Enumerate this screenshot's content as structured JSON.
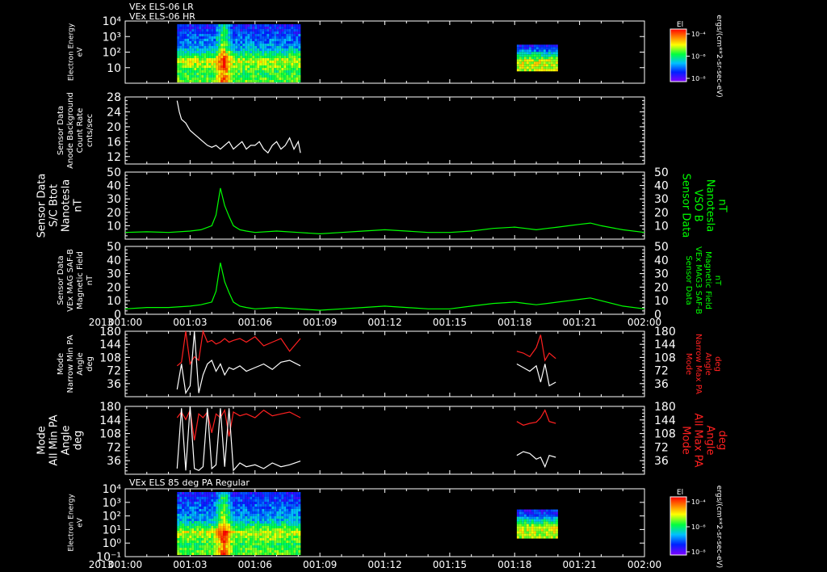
{
  "colors": {
    "white": "#ffffff",
    "green": "#00ff00",
    "red": "#ff2020",
    "background": "#000000"
  },
  "time_axis": {
    "ticks": [
      "001:00",
      "001:03",
      "001:06",
      "001:09",
      "001:12",
      "001:15",
      "001:18",
      "001:21",
      "002:00"
    ],
    "year_label": "2013"
  },
  "chart_data": [
    {
      "id": "panel1",
      "type": "heatmap",
      "titles": [
        "VEx ELS-06 LR",
        "VEx ELS-06 HR"
      ],
      "ylabel": [
        "Electron Energy",
        "eV"
      ],
      "yscale": "log",
      "ylim": [
        1,
        10000
      ],
      "yticks": [
        {
          "v": 10,
          "label": "10"
        },
        {
          "v": 100,
          "label": "10²"
        },
        {
          "v": 1000,
          "label": "10³"
        },
        {
          "v": 10000,
          "label": "10⁴"
        }
      ],
      "colorbar": {
        "title": "El",
        "ticks": [
          "10⁻⁴",
          "10⁻⁶",
          "10⁻⁸"
        ],
        "unit": "ergs/(cm**2-sr-sec-eV)"
      },
      "data_intervals": [
        [
          2.4,
          8.1
        ],
        [
          18.1,
          19.9
        ]
      ]
    },
    {
      "id": "panel2",
      "type": "line",
      "ylabel": [
        "Sensor Data",
        "Anode Background",
        "Count Rate",
        "cnts/sec"
      ],
      "ylim": [
        10,
        28
      ],
      "yticks": [
        12,
        16,
        20,
        24,
        28
      ],
      "series": [
        {
          "color": "white",
          "x": [
            2.4,
            2.5,
            2.6,
            2.8,
            3.0,
            3.2,
            3.4,
            3.6,
            3.8,
            4.0,
            4.2,
            4.4,
            4.6,
            4.8,
            5.0,
            5.2,
            5.4,
            5.6,
            5.8,
            6.0,
            6.2,
            6.4,
            6.6,
            6.8,
            7.0,
            7.2,
            7.4,
            7.6,
            7.8,
            8.0,
            8.1
          ],
          "y": [
            27,
            24,
            22,
            21,
            19,
            18,
            17,
            16,
            15,
            14.5,
            15,
            14,
            15,
            16,
            14,
            15,
            16,
            14,
            15,
            15,
            16,
            14,
            13,
            15,
            16,
            14,
            15,
            17,
            14,
            16,
            13
          ]
        }
      ]
    },
    {
      "id": "panel3",
      "type": "line",
      "ylabel": [
        "Sensor Data",
        "S/C Btot",
        "Nanotesla",
        "nT"
      ],
      "ylabel_right": [
        "Sensor Data",
        "VSO B",
        "Nanotesla",
        "nT"
      ],
      "ylim": [
        0,
        50
      ],
      "yticks": [
        10,
        20,
        30,
        40,
        50
      ],
      "series": [
        {
          "color": "green",
          "x": [
            0,
            1,
            2,
            3,
            3.5,
            4.0,
            4.2,
            4.4,
            4.6,
            4.8,
            5.0,
            5.3,
            5.6,
            6,
            7,
            8,
            9,
            10,
            11,
            12,
            13,
            14,
            15,
            16,
            17,
            18,
            18.5,
            19,
            19.5,
            20,
            20.5,
            21,
            21.5,
            22,
            23,
            24
          ],
          "y": [
            5,
            5.5,
            5,
            6,
            7,
            10,
            18,
            38,
            25,
            17,
            10,
            7,
            6,
            5,
            6,
            5,
            4,
            5,
            6,
            7,
            6,
            5,
            5,
            6,
            8,
            9,
            8,
            7,
            8,
            9,
            10,
            11,
            12,
            10,
            7,
            5
          ]
        }
      ]
    },
    {
      "id": "panel4",
      "type": "line",
      "ylabel": [
        "Sensor Data",
        "VEx MAG SAF-B",
        "Magnetic Field",
        "nT"
      ],
      "ylabel_right": [
        "Sensor Data",
        "VEx MAG3 SAF-B",
        "Magnetic Field",
        "nT"
      ],
      "ylim": [
        0,
        50
      ],
      "yticks": [
        0,
        10,
        20,
        30,
        40,
        50
      ],
      "series": [
        {
          "color": "green",
          "x": [
            0,
            1,
            2,
            3,
            3.5,
            4.0,
            4.2,
            4.4,
            4.6,
            4.8,
            5.0,
            5.3,
            5.6,
            6,
            7,
            8,
            9,
            10,
            11,
            12,
            13,
            14,
            15,
            16,
            17,
            18,
            18.5,
            19,
            19.5,
            20,
            20.5,
            21,
            21.5,
            22,
            23,
            24
          ],
          "y": [
            4,
            5,
            5,
            6,
            7,
            9,
            17,
            38,
            24,
            16,
            9,
            6,
            5,
            4,
            5,
            4,
            3,
            4,
            5,
            6,
            5,
            4,
            4,
            6,
            8,
            9,
            8,
            7,
            8,
            9,
            10,
            11,
            12,
            10,
            6,
            4
          ]
        }
      ]
    },
    {
      "id": "panel5",
      "type": "line",
      "ylabel": [
        "Mode",
        "Narrow Min PA",
        "Angle",
        "deg"
      ],
      "ylabel_right": [
        "Mode",
        "Narrow Max PA",
        "Angle",
        "deg"
      ],
      "ylim": [
        0,
        180
      ],
      "yticks": [
        36,
        72,
        108,
        144,
        180
      ],
      "series": [
        {
          "color": "red",
          "x": [
            2.4,
            2.6,
            2.8,
            3.0,
            3.2,
            3.4,
            3.6,
            3.8,
            4.0,
            4.2,
            4.4,
            4.6,
            4.8,
            5.0,
            5.3,
            5.6,
            6,
            6.4,
            6.8,
            7.2,
            7.6,
            8.1
          ],
          "y": [
            85,
            95,
            180,
            90,
            110,
            100,
            180,
            150,
            155,
            145,
            150,
            160,
            150,
            155,
            160,
            150,
            165,
            140,
            150,
            160,
            125,
            160
          ]
        },
        {
          "color": "red",
          "x": [
            18.1,
            18.4,
            18.7,
            19.0,
            19.2,
            19.4,
            19.6,
            19.9
          ],
          "y": [
            125,
            120,
            110,
            135,
            170,
            100,
            120,
            105
          ]
        },
        {
          "color": "white",
          "x": [
            2.4,
            2.6,
            2.8,
            3.0,
            3.2,
            3.4,
            3.6,
            3.8,
            4.0,
            4.2,
            4.4,
            4.6,
            4.8,
            5.0,
            5.3,
            5.6,
            6,
            6.4,
            6.8,
            7.2,
            7.6,
            8.1
          ],
          "y": [
            20,
            90,
            10,
            30,
            180,
            10,
            60,
            90,
            100,
            70,
            90,
            60,
            80,
            75,
            85,
            70,
            80,
            90,
            75,
            95,
            100,
            85
          ]
        },
        {
          "color": "white",
          "x": [
            18.1,
            18.4,
            18.7,
            19.0,
            19.2,
            19.4,
            19.6,
            19.9
          ],
          "y": [
            90,
            80,
            70,
            85,
            40,
            90,
            30,
            40
          ]
        }
      ]
    },
    {
      "id": "panel6",
      "type": "line",
      "ylabel": [
        "Mode",
        "All Min PA",
        "Angle",
        "deg"
      ],
      "ylabel_right": [
        "Mode",
        "All Max PA",
        "Angle",
        "deg"
      ],
      "ylim": [
        0,
        180
      ],
      "yticks": [
        36,
        72,
        108,
        144,
        180
      ],
      "series": [
        {
          "color": "red",
          "x": [
            2.4,
            2.6,
            2.8,
            3.0,
            3.2,
            3.4,
            3.6,
            3.8,
            4.0,
            4.2,
            4.4,
            4.6,
            4.8,
            5.0,
            5.3,
            5.6,
            6,
            6.4,
            6.8,
            7.2,
            7.6,
            8.1
          ],
          "y": [
            150,
            165,
            145,
            170,
            90,
            160,
            150,
            165,
            110,
            160,
            150,
            170,
            100,
            165,
            155,
            160,
            150,
            170,
            155,
            160,
            165,
            150
          ]
        },
        {
          "color": "red",
          "x": [
            18.1,
            18.4,
            18.7,
            19.0,
            19.2,
            19.4,
            19.6,
            19.9
          ],
          "y": [
            140,
            130,
            135,
            138,
            150,
            170,
            140,
            135
          ]
        },
        {
          "color": "white",
          "x": [
            2.4,
            2.6,
            2.8,
            3.0,
            3.2,
            3.4,
            3.6,
            3.8,
            4.0,
            4.2,
            4.4,
            4.6,
            4.8,
            5.0,
            5.3,
            5.6,
            6,
            6.4,
            6.8,
            7.2,
            7.6,
            8.1
          ],
          "y": [
            15,
            175,
            10,
            180,
            15,
            10,
            20,
            175,
            15,
            25,
            175,
            20,
            175,
            10,
            30,
            20,
            25,
            15,
            30,
            20,
            25,
            35
          ]
        },
        {
          "color": "white",
          "x": [
            18.1,
            18.4,
            18.7,
            19.0,
            19.2,
            19.4,
            19.6,
            19.9
          ],
          "y": [
            50,
            60,
            55,
            40,
            45,
            20,
            50,
            45
          ]
        }
      ]
    },
    {
      "id": "panel7",
      "type": "heatmap",
      "titles": [
        "VEx ELS 85 deg PA Regular"
      ],
      "ylabel": [
        "Electron Energy",
        "eV"
      ],
      "yscale": "log",
      "ylim": [
        0.1,
        10000
      ],
      "yticks": [
        {
          "v": 0.1,
          "label": "10⁻¹"
        },
        {
          "v": 1,
          "label": "10⁰"
        },
        {
          "v": 10,
          "label": "10¹"
        },
        {
          "v": 100,
          "label": "10²"
        },
        {
          "v": 1000,
          "label": "10³"
        },
        {
          "v": 10000,
          "label": "10⁴"
        }
      ],
      "colorbar": {
        "title": "El",
        "ticks": [
          "10⁻⁴",
          "10⁻⁶",
          "10⁻⁸"
        ],
        "unit": "ergs/(cm**2-sr-sec-eV)"
      },
      "data_intervals": [
        [
          2.4,
          8.1
        ],
        [
          18.1,
          19.9
        ]
      ]
    }
  ]
}
